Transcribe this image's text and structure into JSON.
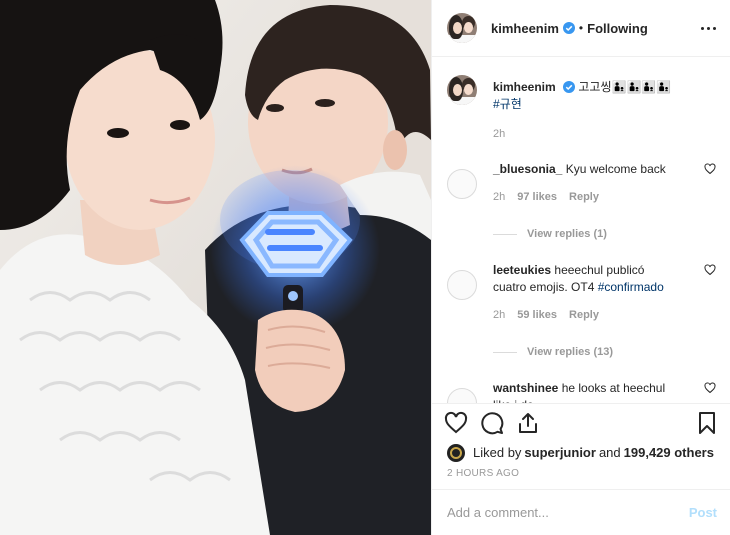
{
  "post": {
    "username": "kimheenim",
    "separator": "•",
    "follow_status": "Following"
  },
  "caption": {
    "username": "kimheenim",
    "text": "고고씽👨‍👦👨‍👦👨‍👦👨‍👦",
    "hashtag": "#규현",
    "time": "2h"
  },
  "comments": [
    {
      "username": "_bluesonia_",
      "text": "Kyu welcome back",
      "time": "2h",
      "likes": "97 likes",
      "reply_label": "Reply",
      "view_replies": "View replies (1)"
    },
    {
      "username": "leeteukies",
      "text": "heeechul publicó cuatro emojis. OT4 ",
      "hashtag": "#confirmado",
      "time": "2h",
      "likes": "59 likes",
      "reply_label": "Reply",
      "view_replies": "View replies (13)"
    },
    {
      "username": "wantshinee",
      "text": "he looks at heechul like i do"
    }
  ],
  "liked_by": {
    "prefix": "Liked by ",
    "user": "superjunior",
    "middle": " and ",
    "count": "199,429 others"
  },
  "posted_time": "2 HOURS AGO",
  "add_comment": {
    "placeholder": "Add a comment...",
    "post_label": "Post"
  },
  "icons": {
    "verified": "verified-badge-icon",
    "more": "more-options-icon",
    "like": "heart-icon",
    "comment": "comment-bubble-icon",
    "share": "share-icon",
    "save": "bookmark-icon"
  },
  "colors": {
    "link": "#003569",
    "verified": "#3897f0",
    "muted": "#999999",
    "post_disabled": "#b2dffc"
  }
}
